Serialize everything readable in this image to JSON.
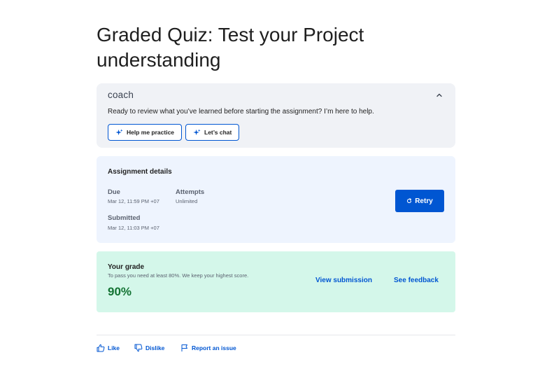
{
  "page": {
    "title": "Graded Quiz: Test your Project understanding"
  },
  "coach": {
    "logo": "coach",
    "message": "Ready to review what you’ve learned before starting the assignment? I’m here to help.",
    "buttons": [
      {
        "label": "Help me practice",
        "icon": "sparkle-icon"
      },
      {
        "label": "Let’s chat",
        "icon": "sparkle-icon"
      }
    ],
    "collapse_icon": "chevron-up-icon"
  },
  "assignment": {
    "heading": "Assignment details",
    "due_label": "Due",
    "due_value": "Mar 12, 11:59 PM +07",
    "attempts_label": "Attempts",
    "attempts_value": "Unlimited",
    "submitted_label": "Submitted",
    "submitted_value": "Mar 12, 11:03 PM +07",
    "retry_label": "Retry",
    "retry_icon": "refresh-icon"
  },
  "grade": {
    "heading": "Your grade",
    "note": "To pass you need at least 80%. We keep your highest score.",
    "value": "90%",
    "view_submission": "View submission",
    "see_feedback": "See feedback"
  },
  "footer": {
    "like": "Like",
    "dislike": "Dislike",
    "report": "Report an issue"
  },
  "colors": {
    "primary": "#0056d2",
    "coach_bg": "#f0f2f6",
    "assignment_bg": "#eef4fe",
    "grade_bg": "#d4f7ea",
    "grade_text": "#137333"
  }
}
